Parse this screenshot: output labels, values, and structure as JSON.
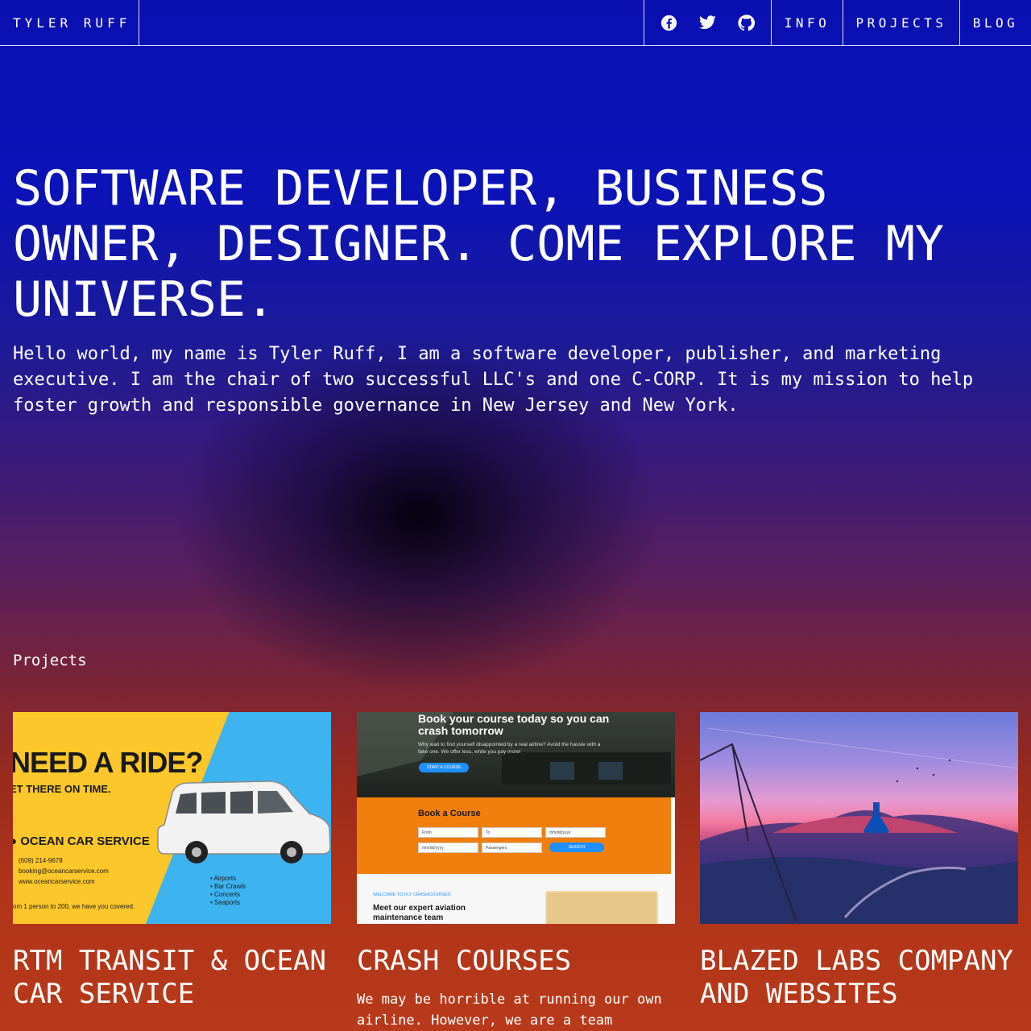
{
  "nav": {
    "brand": "TYLER RUFF",
    "social": [
      "facebook-icon",
      "twitter-icon",
      "github-icon"
    ],
    "links": [
      "INFO",
      "PROJECTS",
      "BLOG"
    ]
  },
  "hero": {
    "title": "SOFTWARE DEVELOPER, BUSINESS OWNER, DESIGNER. COME EXPLORE MY UNIVERSE.",
    "text": "Hello world, my name is Tyler Ruff, I am a software developer, publisher, and marketing executive. I am the chair of two successful LLC's and one C-CORP. It is my mission to help foster growth and responsible governance in New Jersey and New York."
  },
  "projects": {
    "label": "Projects",
    "items": [
      {
        "title": "RTM TRANSIT & OCEAN CAR SERVICE",
        "description": "",
        "thumb": {
          "headline": "NEED A RIDE?",
          "subline": "ET THERE ON TIME.",
          "company": "OCEAN CAR SERVICE",
          "phone": "(609) 214-9678",
          "email": "booking@oceancarservice.com",
          "website": "www.oceancarservice.com",
          "tagline": "om 1 person to 200, we have you covered.",
          "bullets": [
            "Airports",
            "Bar Crawls",
            "Concerts",
            "Seaports"
          ]
        }
      },
      {
        "title": "CRASH COURSES",
        "description": "We may be horrible at running our own airline. However, we are a team",
        "thumb": {
          "headline": "Book your course today so you can crash tomorrow",
          "subtext": "Why wait to find yourself disappointed by a real airline? Avoid the hassle with a fake one. We offer less, while you pay more!",
          "cta": "START A COURSE",
          "form_title": "Book a Course",
          "fields": [
            "From",
            "To",
            "mm/dd/yyyy",
            "mm/dd/yyyy",
            "Passengers"
          ],
          "search": "SEARCH",
          "welcome": "WELCOME TO FLY CRASHCOURSES",
          "meet": "Meet our expert aviation maintenance team"
        }
      },
      {
        "title": "BLAZED LABS COMPANY AND WEBSITES",
        "description": ""
      }
    ]
  },
  "colors": {
    "nav_border": "#ffffff",
    "bg_top": "#0a0fb0",
    "bg_bottom": "#b8391b"
  }
}
